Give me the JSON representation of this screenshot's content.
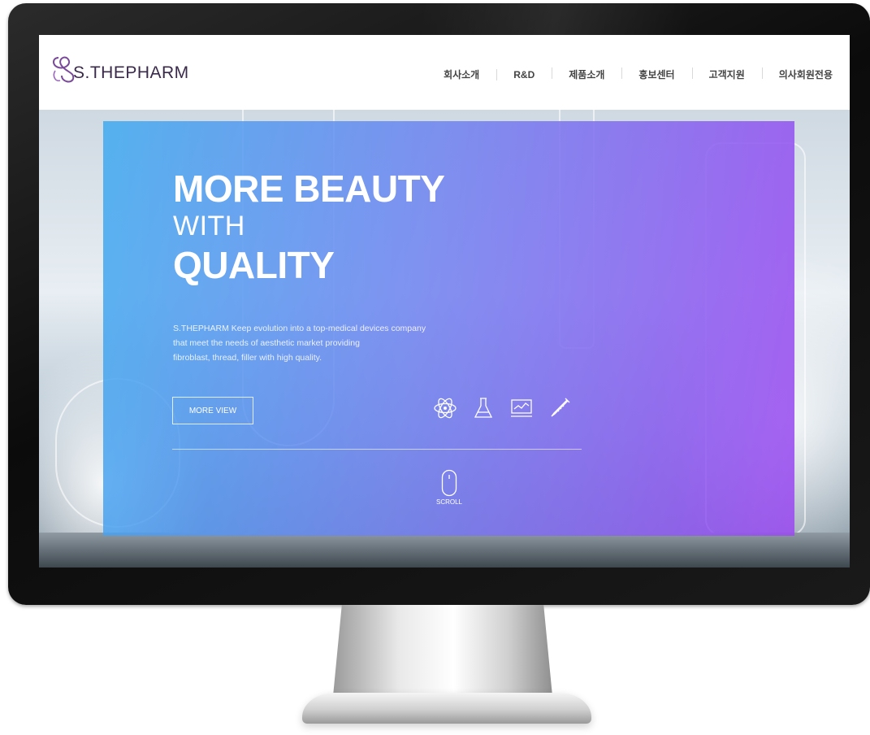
{
  "header": {
    "logo_text": "S.THEPHARM",
    "nav": [
      "회사소개",
      "R&D",
      "제품소개",
      "홍보센터",
      "고객지원",
      "의사회원전용"
    ]
  },
  "hero": {
    "headline_1": "MORE BEAUTY",
    "headline_2": "WITH",
    "headline_3": "QUALITY",
    "description": [
      "S.THEPHARM Keep evolution into a top-medical devices company",
      "that meet the needs of aesthetic market providing",
      "fibroblast, thread, filler with high quality."
    ],
    "button_label": "MORE VIEW",
    "icons": [
      "atom-icon",
      "flask-icon",
      "monitor-chart-icon",
      "syringe-icon"
    ],
    "scroll_label": "SCROLL"
  },
  "colors": {
    "gradient_start": "#3faaf0",
    "gradient_mid": "#6e82f0",
    "gradient_end": "#9b4bf0",
    "logo_accent": "#7a4a9a"
  }
}
